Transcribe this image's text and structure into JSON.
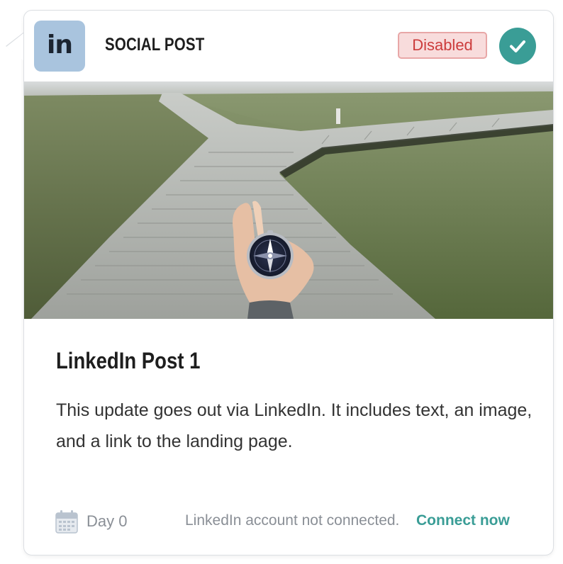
{
  "header": {
    "platform_icon_text": "in",
    "post_type": "SOCIAL POST",
    "status": "Disabled",
    "status_icon": "check-icon"
  },
  "hero": {
    "image_icon": "compass-boardwalk-photo"
  },
  "post": {
    "title": "LinkedIn Post 1",
    "description": "This update goes out via LinkedIn. It includes text, an image, and a link to the landing page."
  },
  "footer": {
    "schedule_icon": "calendar-icon",
    "day_label": "Day 0",
    "connection_note": "LinkedIn account not connected.",
    "connect_link": "Connect now"
  },
  "colors": {
    "linkedin_badge_bg": "#a9c4de",
    "status_disabled_bg": "#f8dcdc",
    "status_disabled_border": "#e8a7a7",
    "status_disabled_text": "#cc3c3c",
    "accent_teal": "#3a9d96",
    "muted_text": "#8a8f96"
  }
}
